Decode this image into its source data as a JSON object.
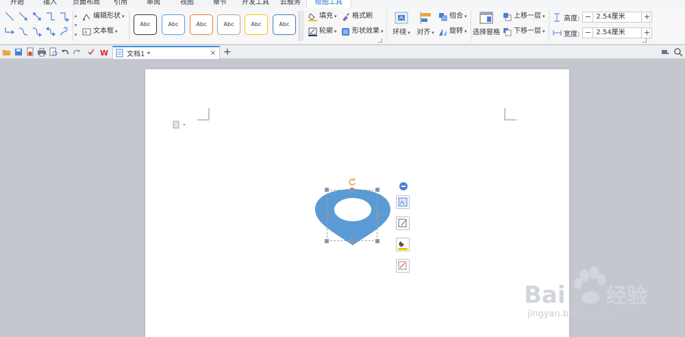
{
  "menu": {
    "tabs": [
      {
        "label": "开始",
        "active": false
      },
      {
        "label": "插入",
        "active": false
      },
      {
        "label": "页面布局",
        "active": false
      },
      {
        "label": "引用",
        "active": false
      },
      {
        "label": "审阅",
        "active": false
      },
      {
        "label": "视图",
        "active": false
      },
      {
        "label": "章节",
        "active": false
      },
      {
        "label": "开发工具",
        "active": false
      },
      {
        "label": "云服务",
        "active": false
      },
      {
        "label": "绘图工具",
        "active": true
      }
    ]
  },
  "ribbon": {
    "edit_shape": "编辑形状",
    "text_box": "文本框",
    "shape_styles": [
      {
        "label": "Abc",
        "color": "#333333"
      },
      {
        "label": "Abc",
        "color": "#5b9bd5"
      },
      {
        "label": "Abc",
        "color": "#ed7d31"
      },
      {
        "label": "Abc",
        "color": "#a5a5a5"
      },
      {
        "label": "Abc",
        "color": "#ffc000"
      },
      {
        "label": "Abc",
        "color": "#4472c4"
      }
    ],
    "fill": "填充",
    "format_painter": "格式刷",
    "outline": "轮廓",
    "shape_effects": "形状效果",
    "wrap": "环绕",
    "align": "对齐",
    "group": "组合",
    "rotate": "旋转",
    "selection_pane": "选择窗格",
    "bring_forward": "上移一层",
    "send_backward": "下移一层",
    "height_label": "高度:",
    "height_value": "2.54厘米",
    "width_label": "宽度:",
    "width_value": "2.54厘米",
    "minus": "−",
    "plus": "+"
  },
  "doc_tab": {
    "title": "文档1 *",
    "close": "×",
    "new_tab": "+"
  },
  "shape": {
    "fill_color": "#5b9bd5"
  },
  "watermark": {
    "url": "jingyan.baidu.com"
  },
  "colors": {
    "accent": "#2b6fd1",
    "tab_border": "#3c8ee6"
  }
}
